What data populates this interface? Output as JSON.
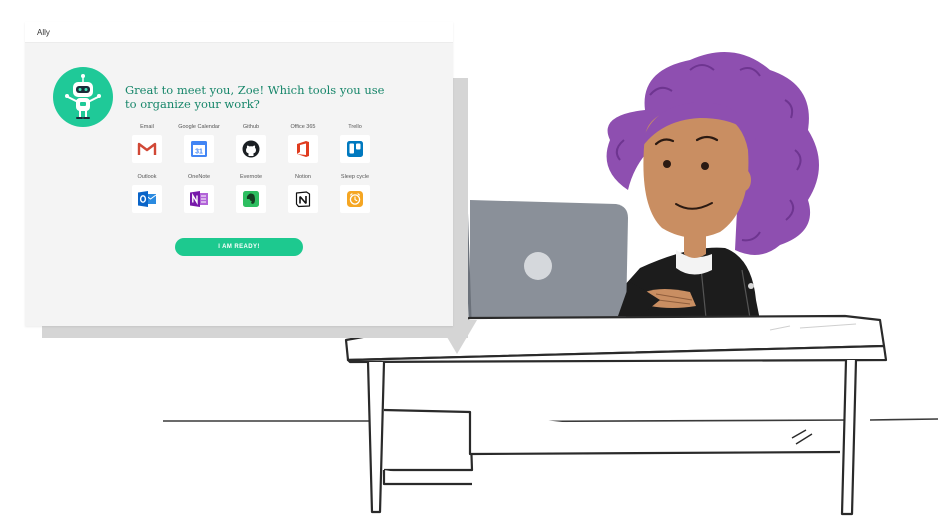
{
  "window": {
    "title": "Ally"
  },
  "greeting": "Great to meet you, Zoe! Which tools you use to organize your work?",
  "tools": [
    {
      "label": "Email",
      "icon": "gmail-icon",
      "color": "#d14836"
    },
    {
      "label": "Google Calendar",
      "icon": "google-calendar-icon",
      "color": "#4285f4"
    },
    {
      "label": "Github",
      "icon": "github-icon",
      "color": "#1b1f23"
    },
    {
      "label": "Office 365",
      "icon": "office-365-icon",
      "color": "#e03c1f"
    },
    {
      "label": "Trello",
      "icon": "trello-icon",
      "color": "#0079bf"
    },
    {
      "label": "Outlook",
      "icon": "outlook-icon",
      "color": "#0a64c8"
    },
    {
      "label": "OneNote",
      "icon": "onenote-icon",
      "color": "#7719aa"
    },
    {
      "label": "Evernote",
      "icon": "evernote-icon",
      "color": "#2dbe60"
    },
    {
      "label": "Notion",
      "icon": "notion-icon",
      "color": "#111111"
    },
    {
      "label": "Sleep cycle",
      "icon": "sleep-cycle-icon",
      "color": "#f5a623"
    }
  ],
  "ready_button": {
    "label": "I AM READY!"
  },
  "calendar_icon_text": "31",
  "colors": {
    "accent": "#1fc998",
    "greeting": "#17866a",
    "hair": "#8e4fb0",
    "skin": "#c98e62"
  }
}
